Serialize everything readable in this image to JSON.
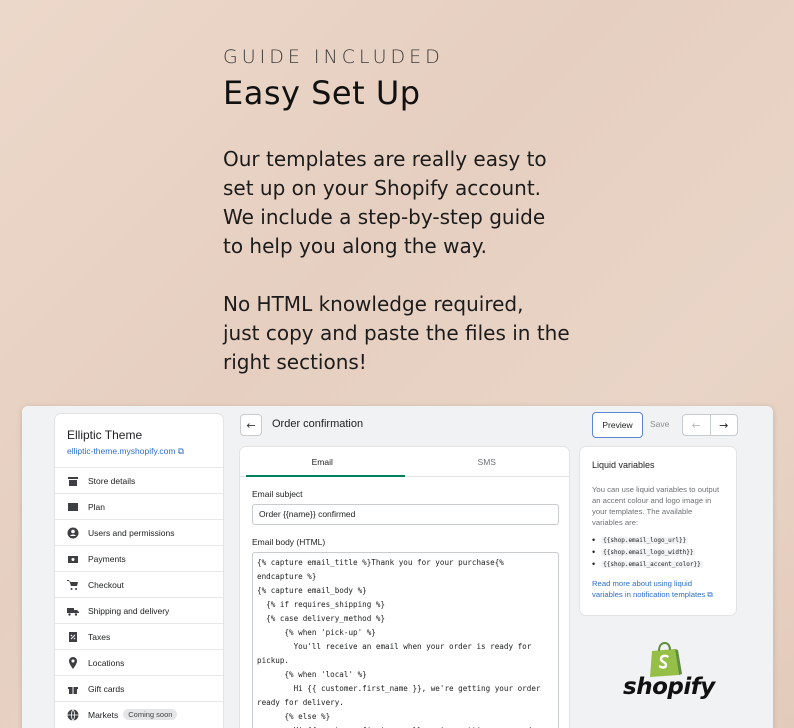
{
  "hero": {
    "eyebrow": "GUIDE INCLUDED",
    "title": "Easy Set Up",
    "p1": [
      "Our templates are really easy to",
      "set up on your Shopify account.",
      "We include a step-by-step guide",
      "to help you along the way."
    ],
    "p2": [
      "No HTML knowledge required,",
      "just copy and paste the files in the",
      "right sections!"
    ]
  },
  "sidebar": {
    "store_name": "Elliptic Theme",
    "store_url": "elliptic-theme.myshopify.com",
    "items": [
      {
        "label": "Store details",
        "icon": "store-icon"
      },
      {
        "label": "Plan",
        "icon": "plan-icon"
      },
      {
        "label": "Users and permissions",
        "icon": "user-icon"
      },
      {
        "label": "Payments",
        "icon": "payments-icon"
      },
      {
        "label": "Checkout",
        "icon": "cart-icon"
      },
      {
        "label": "Shipping and delivery",
        "icon": "truck-icon"
      },
      {
        "label": "Taxes",
        "icon": "taxes-icon"
      },
      {
        "label": "Locations",
        "icon": "location-icon"
      },
      {
        "label": "Gift cards",
        "icon": "gift-icon"
      },
      {
        "label": "Markets",
        "icon": "globe-icon",
        "badge": "Coming soon"
      }
    ]
  },
  "topbar": {
    "title": "Order confirmation",
    "preview_label": "Preview",
    "save_label": "Save"
  },
  "editor": {
    "tabs": [
      "Email",
      "SMS"
    ],
    "subject_label": "Email subject",
    "subject_value": "Order {{name}} confirmed",
    "body_label": "Email body (HTML)",
    "code": "{% capture email_title %}Thank you for your purchase{% endcapture %}\n{% capture email_body %}\n  {% if requires_shipping %}\n  {% case delivery_method %}\n      {% when 'pick-up' %}\n        You'll receive an email when your order is ready for pickup.\n      {% when 'local' %}\n        Hi {{ customer.first_name }}, we're getting your order ready for delivery.\n      {% else %}\n        Hi {{ customer.first_name }}, we're getting your order"
  },
  "liquid": {
    "title": "Liquid variables",
    "description": "You can use liquid variables to output an accent colour and logo image in your templates. The available variables are:",
    "variables": [
      "{{shop.email_logo_url}}",
      "{{shop.email_logo_width}}",
      "{{shop.email_accent_color}}"
    ],
    "link": "Read more about using liquid variables in notification templates"
  },
  "logo": {
    "word": "shopify"
  },
  "colors": {
    "accent": "#008060",
    "link": "#2c6ecb",
    "shopify_green": "#95bf47"
  }
}
